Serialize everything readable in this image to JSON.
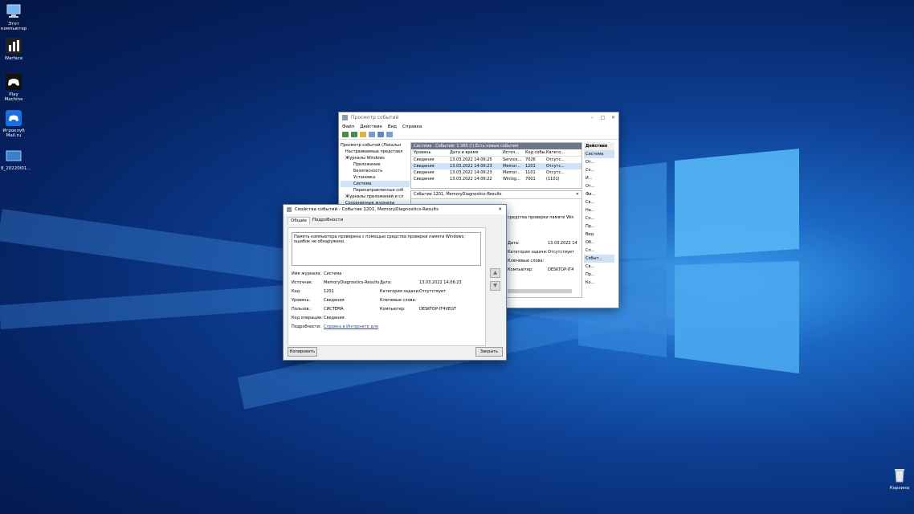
{
  "desktop": {
    "icons": [
      {
        "label": "Этот компьютер",
        "icon": "computer-icon"
      },
      {
        "label": "Warface",
        "icon": "warface-icon"
      },
      {
        "label": "Play Machine",
        "icon": "gamepad-icon"
      },
      {
        "label": "Игроклуб Mail.ru",
        "icon": "gamecenter-icon"
      },
      {
        "label": "8_20220I01...",
        "icon": "file-icon"
      }
    ],
    "recycle_bin": {
      "label": "Корзина",
      "icon": "recycle-bin-icon"
    }
  },
  "event_viewer": {
    "title": "Просмотр событий",
    "menu": [
      "Файл",
      "Действие",
      "Вид",
      "Справка"
    ],
    "tree": [
      "Просмотр событий (Локальн",
      "Настраиваемые представл",
      "Журналы Windows",
      "Приложение",
      "Безопасность",
      "Установка",
      "Система",
      "Перенаправленные соб",
      "Журналы приложений и сл",
      "Сохраненные журналы"
    ],
    "log_header": {
      "name": "Система",
      "info": "Событий: 1 385 (!) Есть новые события"
    },
    "columns": [
      "Уровень",
      "Дата и время",
      "Источ...",
      "Код собы...",
      "Катего..."
    ],
    "rows": [
      [
        "Сведения",
        "13.03.2022 14:06:25",
        "Service...",
        "7026",
        "Отсутс..."
      ],
      [
        "Сведения",
        "13.03.2022 14:06:23",
        "Memor...",
        "1201",
        "Отсутс..."
      ],
      [
        "Сведения",
        "13.03.2022 14:06:23",
        "Memor...",
        "1101",
        "Отсутс..."
      ],
      [
        "Сведения",
        "13.03.2022 14:06:22",
        "Winlog...",
        "7001",
        "(1101)"
      ]
    ],
    "detail_header": "Событие 1201, MemoryDiagnostics-Results",
    "detail_snippet": "средства проверки памяти Win",
    "detail_fields": [
      {
        "label": "Дата:",
        "value": "13.03.2022 14"
      },
      {
        "label": "Категория задачи:",
        "value": "Отсутствует"
      },
      {
        "label": "Ключевые слова:",
        "value": ""
      },
      {
        "label": "Компьютер:",
        "value": "DESKTOP-IT4"
      }
    ],
    "actions": {
      "title": "Действия",
      "section1": "Система",
      "items1": [
        "От...",
        "Со...",
        "И...",
        "От...",
        "Фи...",
        "Св...",
        "На...",
        "Со...",
        "Пр...",
        "Вид",
        "Об...",
        "Сп..."
      ],
      "section2": "Событ...",
      "items2": [
        "Св...",
        "Пр...",
        "Ко..."
      ]
    }
  },
  "properties_dialog": {
    "title": "Свойства событий - Событие 1201, MemoryDiagnostics-Results",
    "tabs": [
      "Общие",
      "Подробности"
    ],
    "message": "Память компьютера проверена с помощью средства проверки памяти Windows; ошибок не обнаружено.",
    "left_fields": [
      {
        "label": "Имя журнала:",
        "value": "Система"
      },
      {
        "label": "Источник:",
        "value": "MemoryDiagnostics-Results"
      },
      {
        "label": "Код",
        "value": "1201"
      },
      {
        "label": "Уровень:",
        "value": "Сведения"
      },
      {
        "label": "Пользов.:",
        "value": "СИСТЕМА"
      },
      {
        "label": "Код операции:",
        "value": "Сведения"
      },
      {
        "label": "Подробности:",
        "value": "Справка в Интернете для"
      }
    ],
    "right_fields": [
      {
        "label": "Дата:",
        "value": "13.03.2022 14:06:23"
      },
      {
        "label": "Категория задачи:",
        "value": "Отсутствует"
      },
      {
        "label": "Ключевые слова:",
        "value": ""
      },
      {
        "label": "Компьютер:",
        "value": "DESKTOP-IT4VEGT"
      }
    ],
    "copy_button": "Копировать",
    "close_button": "Закрыть"
  }
}
